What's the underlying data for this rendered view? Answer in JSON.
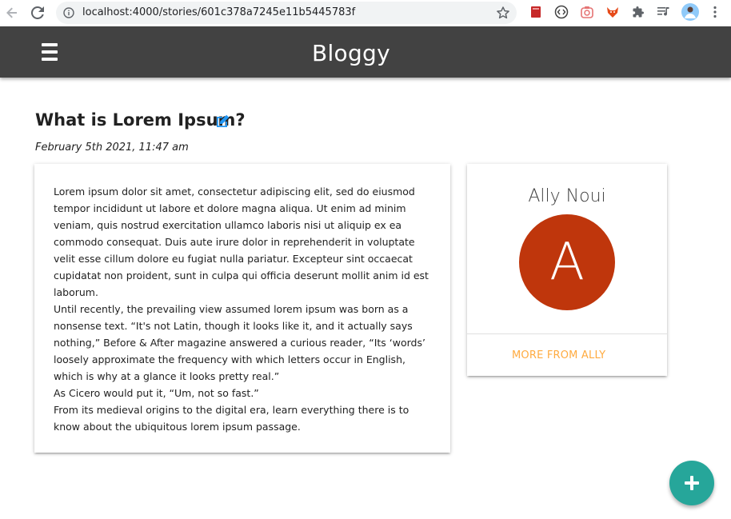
{
  "browser": {
    "url": "localhost:4000/stories/601c378a7245e11b5445783f"
  },
  "app": {
    "brand": "Bloggy",
    "colors": {
      "navbar": "#424242",
      "avatar_bg": "#bf360c",
      "link_accent": "#ffab40",
      "fab": "#26a69a",
      "edit_icon": "#2196f3"
    }
  },
  "story": {
    "title": "What is Lorem Ipsum?",
    "date": "February 5th 2021, 11:47 am",
    "paragraphs": [
      "Lorem ipsum dolor sit amet, consectetur adipiscing elit, sed do eiusmod tempor incididunt ut labore et dolore magna aliqua. Ut enim ad minim veniam, quis nostrud exercitation ullamco laboris nisi ut aliquip ex ea commodo consequat. Duis aute irure dolor in reprehenderit in voluptate velit esse cillum dolore eu fugiat nulla pariatur. Excepteur sint occaecat cupidatat non proident, sunt in culpa qui officia deserunt mollit anim id est laborum.",
      "Until recently, the prevailing view assumed lorem ipsum was born as a nonsense text. “It's not Latin, though it looks like it, and it actually says nothing,” Before & After magazine answered a curious reader, “Its ‘words’ loosely approximate the frequency with which letters occur in English, which is why at a glance it looks pretty real.”",
      "As Cicero would put it, “Um, not so fast.”",
      "From its medieval origins to the digital era, learn everything there is to know about the ubiquitous lorem ipsum passage."
    ]
  },
  "author": {
    "name": "Ally Noui",
    "initial": "A",
    "more_label": "More from Ally"
  },
  "icons": {
    "menu": "hamburger-icon",
    "edit": "edit-icon",
    "fab": "plus-icon"
  }
}
